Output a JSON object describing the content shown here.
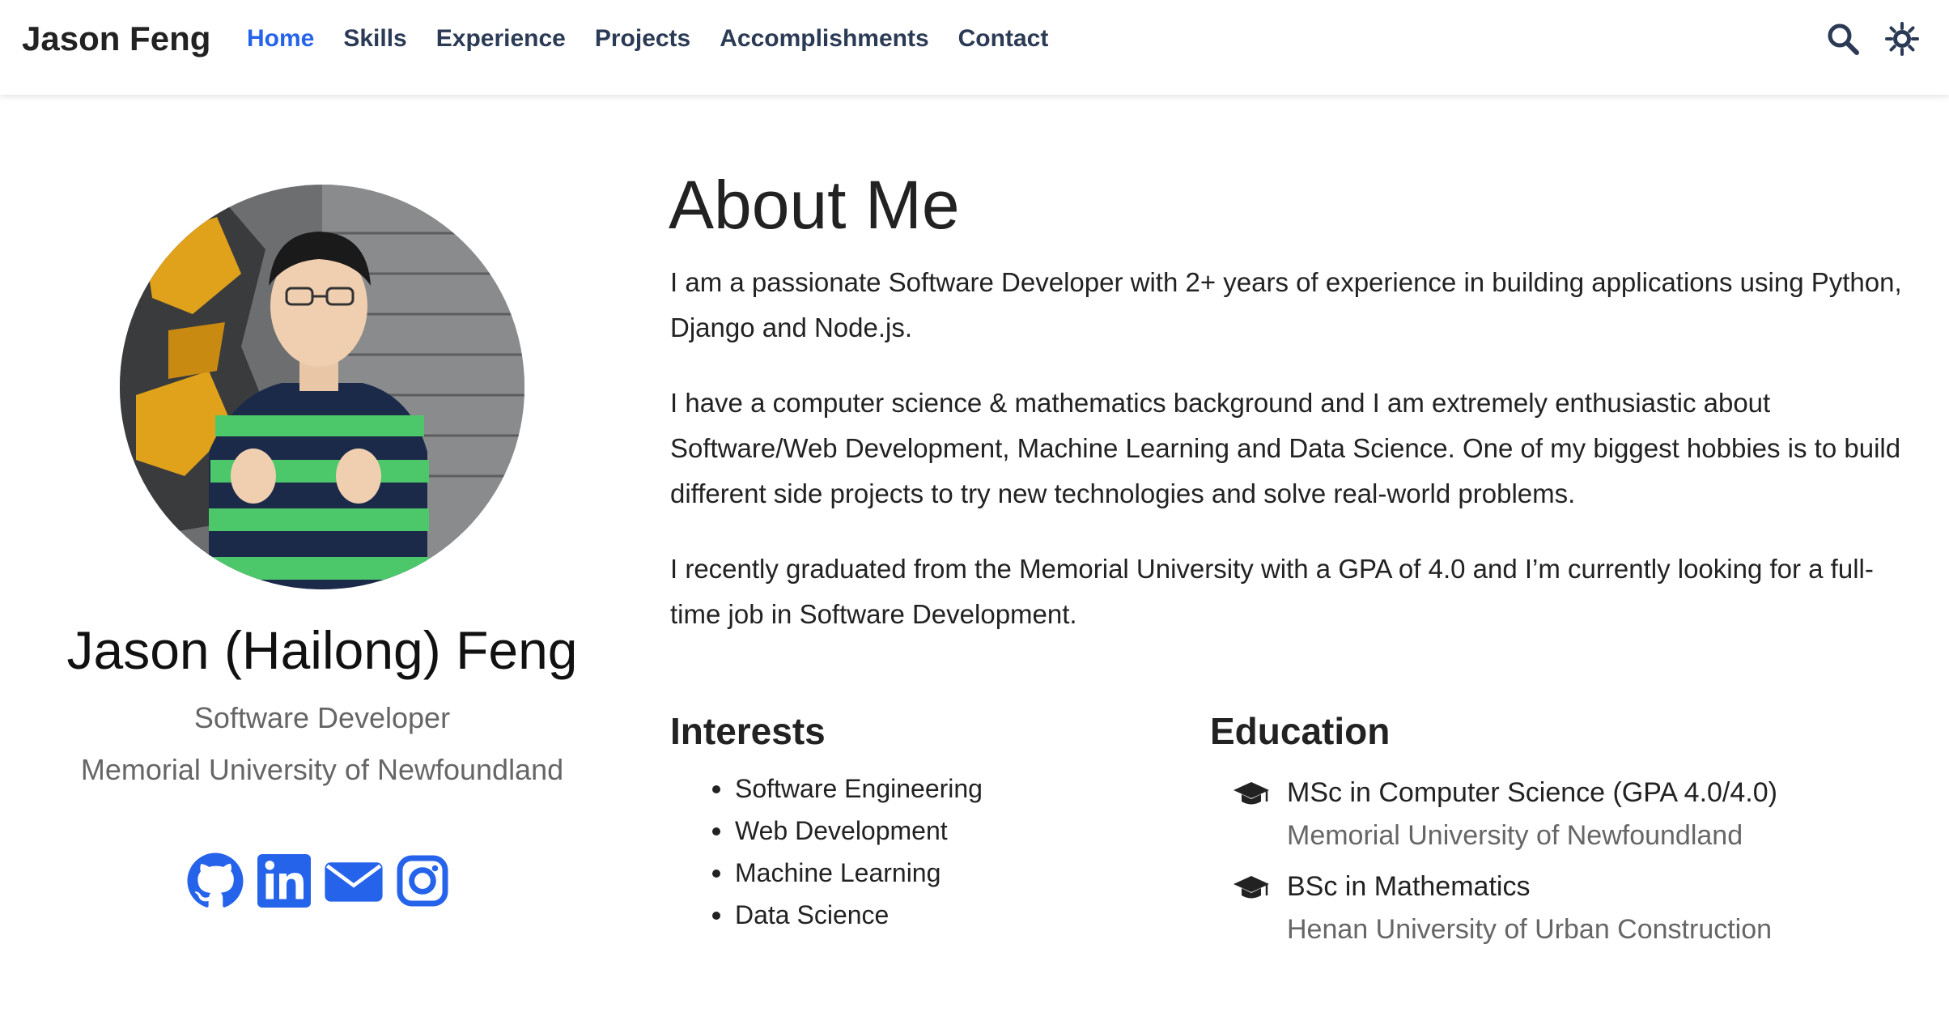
{
  "nav": {
    "brand": "Jason Feng",
    "links": [
      {
        "label": "Home",
        "active": true
      },
      {
        "label": "Skills",
        "active": false
      },
      {
        "label": "Experience",
        "active": false
      },
      {
        "label": "Projects",
        "active": false
      },
      {
        "label": "Accomplishments",
        "active": false
      },
      {
        "label": "Contact",
        "active": false
      }
    ],
    "icons": [
      "search-icon",
      "theme-toggle-icon"
    ]
  },
  "profile": {
    "name": "Jason (Hailong) Feng",
    "role": "Software Developer",
    "organization": "Memorial University of Newfoundland",
    "socials": [
      "github-icon",
      "linkedin-icon",
      "email-icon",
      "instagram-icon"
    ]
  },
  "about": {
    "title": "About Me",
    "paragraphs": [
      "I am a passionate Software Developer with 2+ years of experience in building applications using Python, Django and Node.js.",
      "I have a computer science & mathematics background and I am extremely enthusiastic about Software/Web Development, Machine Learning and Data Science. One of my biggest hobbies is to build different side projects to try new technologies and solve real-world problems.",
      "I recently graduated from the Memorial University with a GPA of 4.0 and I’m currently looking for a full-time job in Software Development."
    ]
  },
  "interests": {
    "title": "Interests",
    "items": [
      "Software Engineering",
      "Web Development",
      "Machine Learning",
      "Data Science"
    ]
  },
  "education": {
    "title": "Education",
    "items": [
      {
        "degree": "MSc in Computer Science (GPA 4.0/4.0)",
        "school": "Memorial University of Newfoundland"
      },
      {
        "degree": "BSc in Mathematics",
        "school": "Henan University of Urban Construction"
      }
    ]
  },
  "colors": {
    "accent": "#2563eb",
    "nav_text": "#2b3a55",
    "muted_text": "#666666"
  }
}
